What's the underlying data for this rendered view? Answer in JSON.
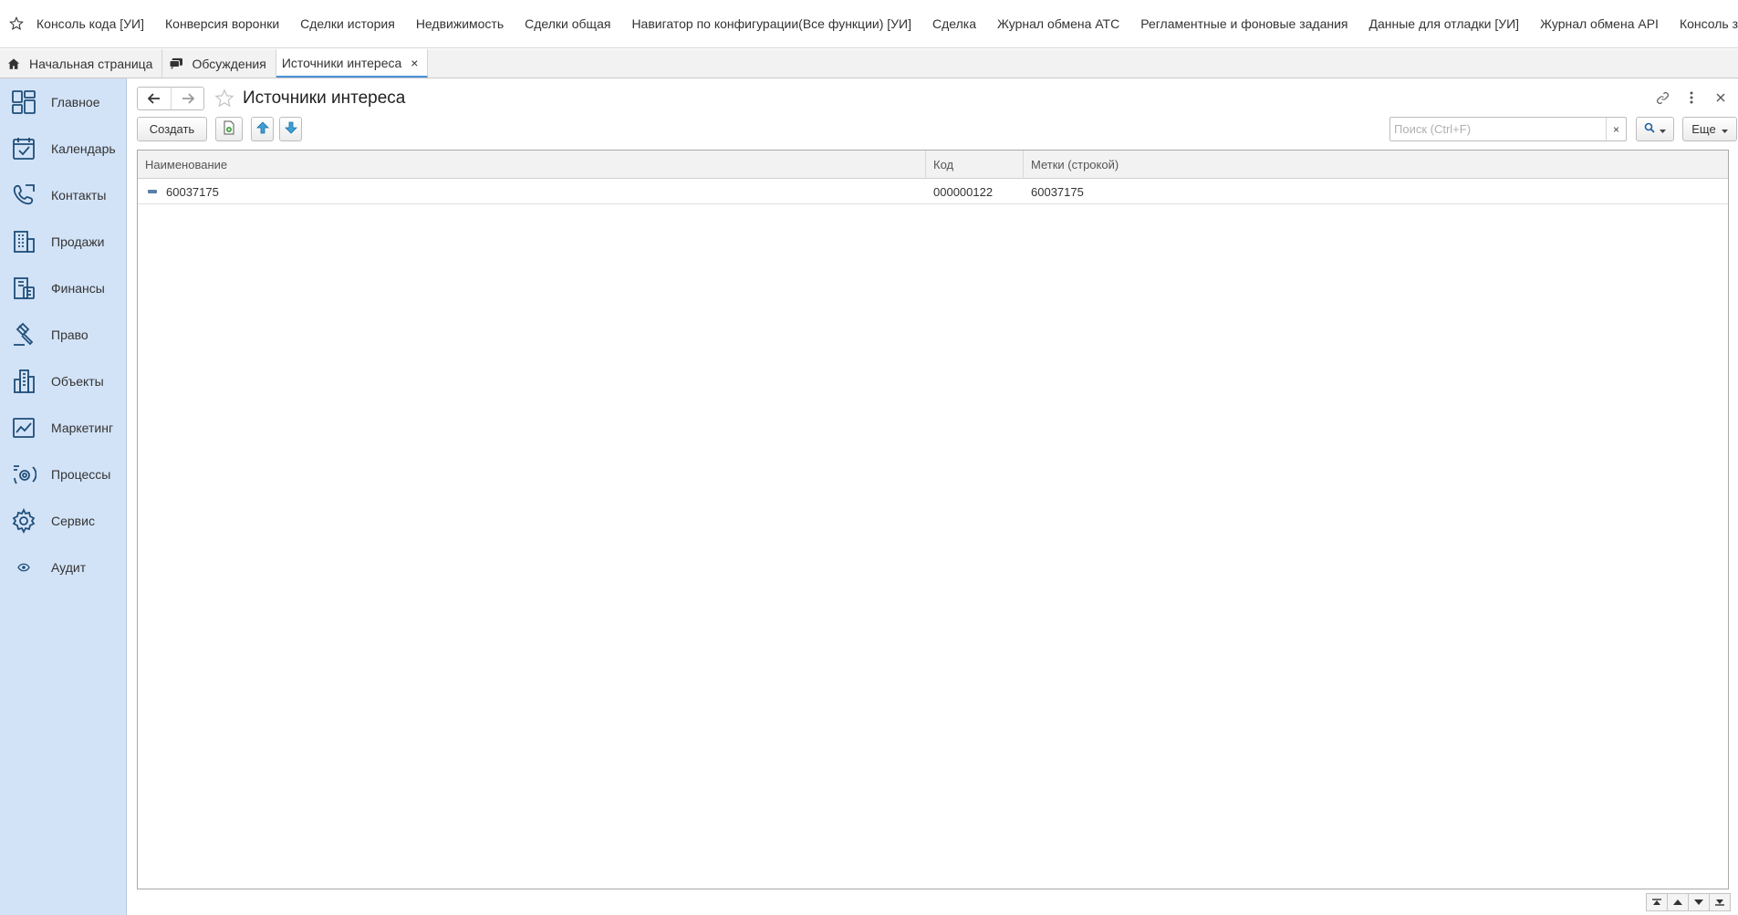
{
  "favorites": {
    "items": [
      {
        "label": "Консоль кода [УИ]"
      },
      {
        "label": "Конверсия воронки"
      },
      {
        "label": "Сделки история"
      },
      {
        "label": "Недвижимость"
      },
      {
        "label": "Сделки общая"
      },
      {
        "label": "Навигатор по конфигурации(Все функции) [УИ]"
      },
      {
        "label": "Сделка"
      },
      {
        "label": "Журнал обмена АТС"
      },
      {
        "label": "Регламентные и фоновые задания"
      },
      {
        "label": "Данные для отладки [УИ]"
      },
      {
        "label": "Журнал обмена API"
      },
      {
        "label": "Консоль запросов [УИ]"
      }
    ]
  },
  "tabs": {
    "home": "Начальная страница",
    "discussions": "Обсуждения",
    "current": "Источники интереса",
    "close_glyph": "×"
  },
  "sidebar": {
    "items": [
      {
        "label": "Главное",
        "icon": "dashboard-icon"
      },
      {
        "label": "Календарь",
        "icon": "calendar-icon"
      },
      {
        "label": "Контакты",
        "icon": "contacts-icon"
      },
      {
        "label": "Продажи",
        "icon": "sales-building-icon"
      },
      {
        "label": "Финансы",
        "icon": "finance-icon"
      },
      {
        "label": "Право",
        "icon": "gavel-icon"
      },
      {
        "label": "Объекты",
        "icon": "buildings-icon"
      },
      {
        "label": "Маркетинг",
        "icon": "chart-icon"
      },
      {
        "label": "Процессы",
        "icon": "processes-icon"
      },
      {
        "label": "Сервис",
        "icon": "gear-icon"
      },
      {
        "label": "Аудит",
        "icon": "eye-icon"
      }
    ]
  },
  "form": {
    "title": "Источники интереса",
    "create_label": "Создать",
    "search_placeholder": "Поиск (Ctrl+F)",
    "search_clear": "×",
    "more_label": "Еще"
  },
  "table": {
    "columns": [
      "Наименование",
      "Код",
      "Метки (строкой)"
    ],
    "rows": [
      {
        "name": "60037175",
        "code": "000000122",
        "tags": "60037175"
      }
    ]
  },
  "colors": {
    "sidebar_bg": "#d3e3f7",
    "icon_color": "#1f4e79",
    "accent": "#4a90d9"
  }
}
